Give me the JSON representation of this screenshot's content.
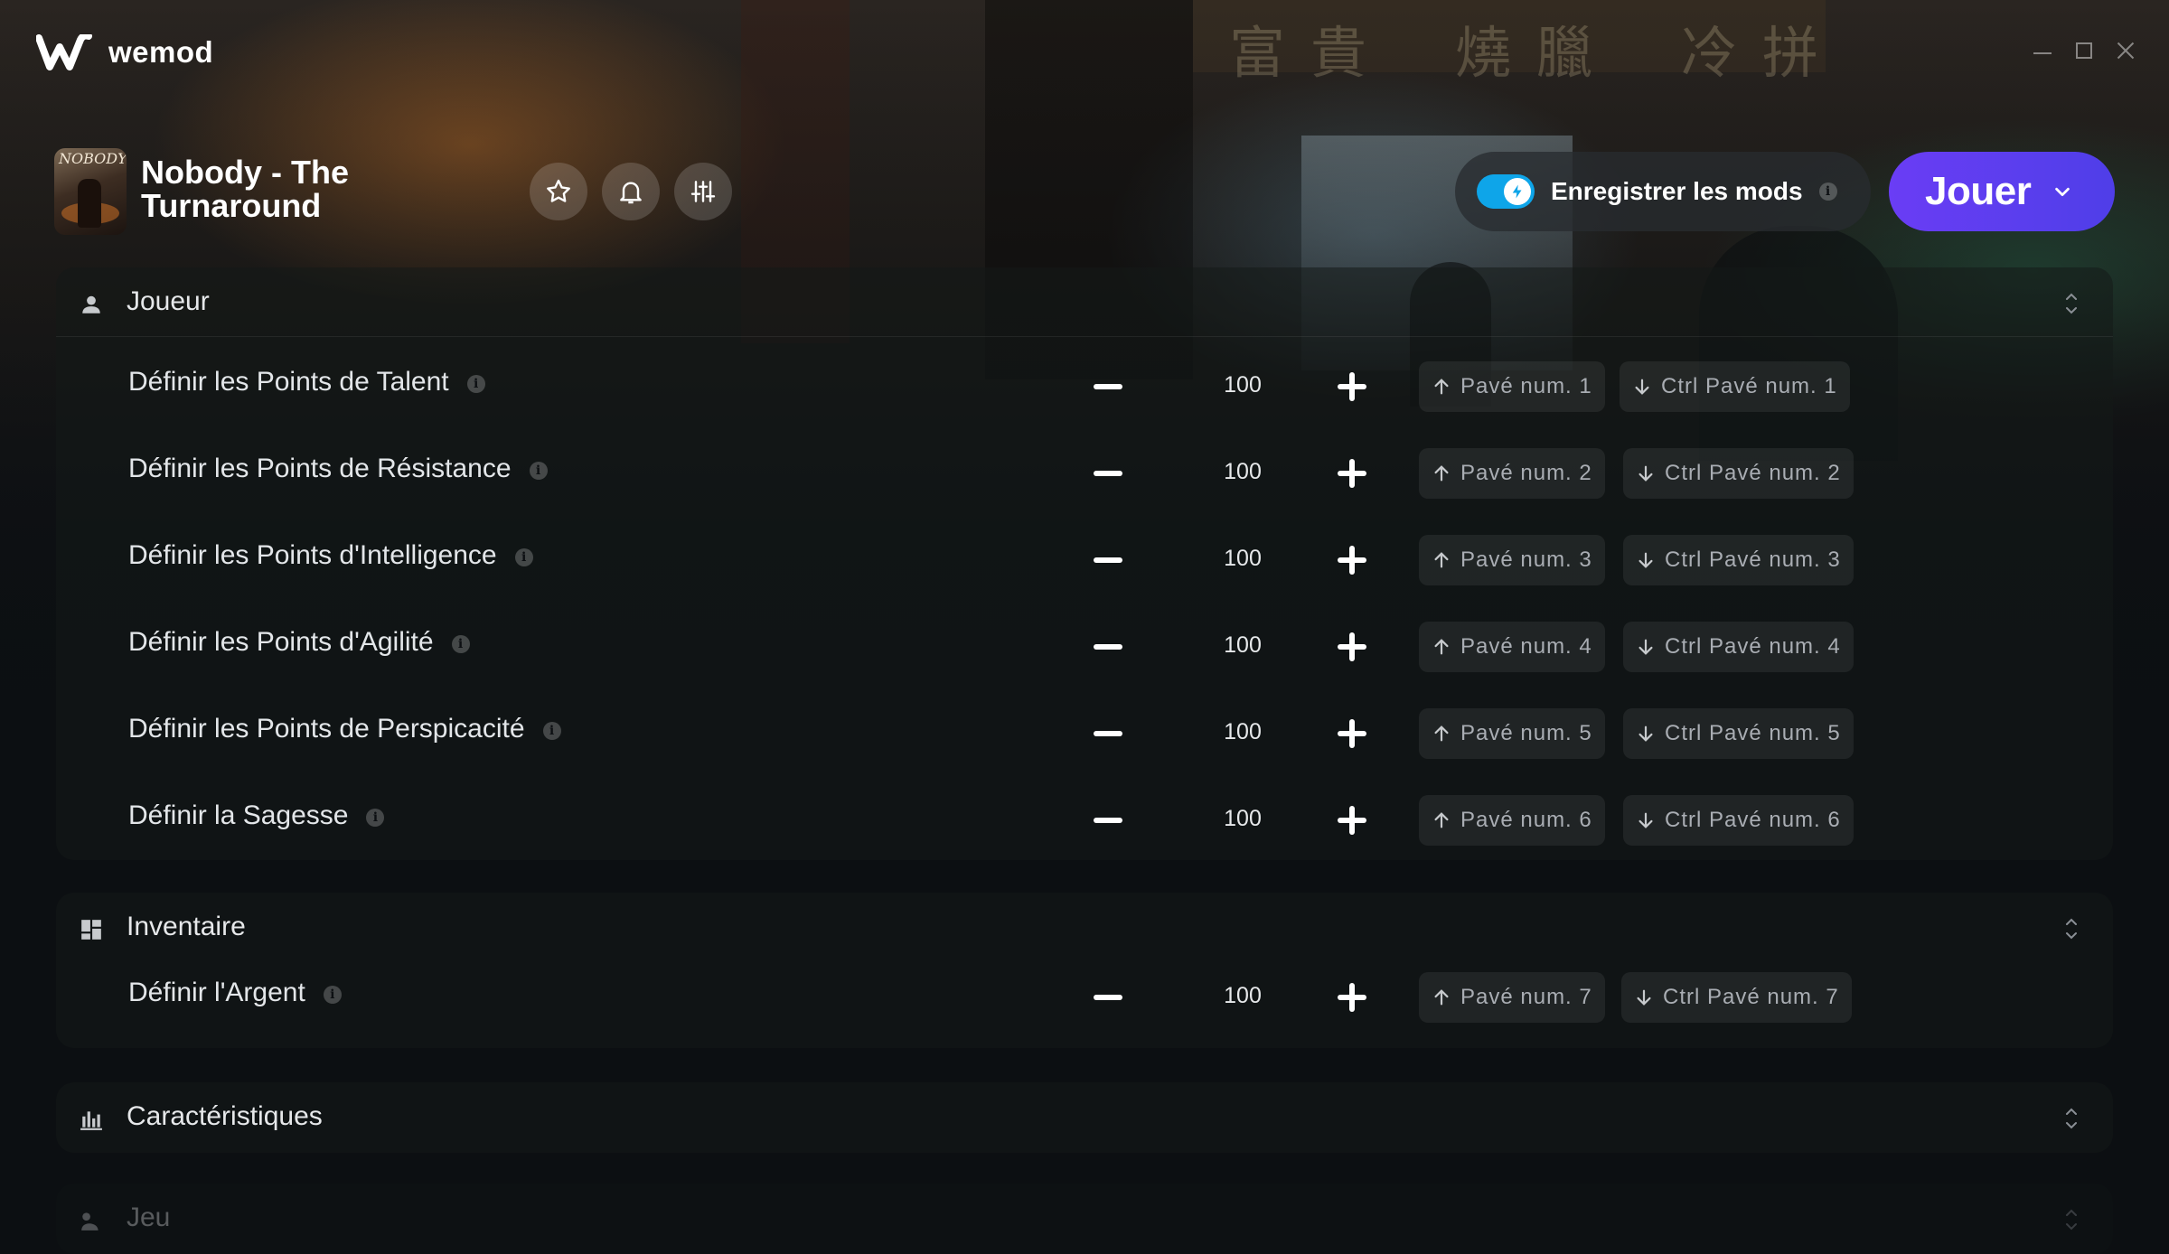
{
  "app": {
    "name": "wemod"
  },
  "game": {
    "title": "Nobody - The Turnaround",
    "thumb_text": "NOBODY"
  },
  "header": {
    "save_mods_label": "Enregistrer les mods",
    "play_label": "Jouer",
    "toggle_on": true,
    "colors": {
      "play": "#5b3df0",
      "toggle": "#0ea5e9"
    }
  },
  "sections": [
    {
      "title": "Joueur",
      "icon": "person-icon",
      "rows": [
        {
          "label": "Définir les Points de Talent",
          "value": "100",
          "inc": "Pavé num. 1",
          "dec": "Ctrl Pavé num. 1"
        },
        {
          "label": "Définir les Points de Résistance",
          "value": "100",
          "inc": "Pavé num. 2",
          "dec": "Ctrl Pavé num. 2"
        },
        {
          "label": "Définir les Points d'Intelligence",
          "value": "100",
          "inc": "Pavé num. 3",
          "dec": "Ctrl Pavé num. 3"
        },
        {
          "label": "Définir les Points d'Agilité",
          "value": "100",
          "inc": "Pavé num. 4",
          "dec": "Ctrl Pavé num. 4"
        },
        {
          "label": "Définir les Points de Perspicacité",
          "value": "100",
          "inc": "Pavé num. 5",
          "dec": "Ctrl Pavé num. 5"
        },
        {
          "label": "Définir la Sagesse",
          "value": "100",
          "inc": "Pavé num. 6",
          "dec": "Ctrl Pavé num. 6"
        }
      ]
    },
    {
      "title": "Inventaire",
      "icon": "dashboard-icon",
      "rows": [
        {
          "label": "Définir l'Argent",
          "value": "100",
          "inc": "Pavé num. 7",
          "dec": "Ctrl Pavé num. 7"
        }
      ]
    },
    {
      "title": "Caractéristiques",
      "icon": "bar-chart-icon",
      "rows": []
    },
    {
      "title": "Jeu",
      "icon": "game-icon",
      "rows": []
    }
  ]
}
